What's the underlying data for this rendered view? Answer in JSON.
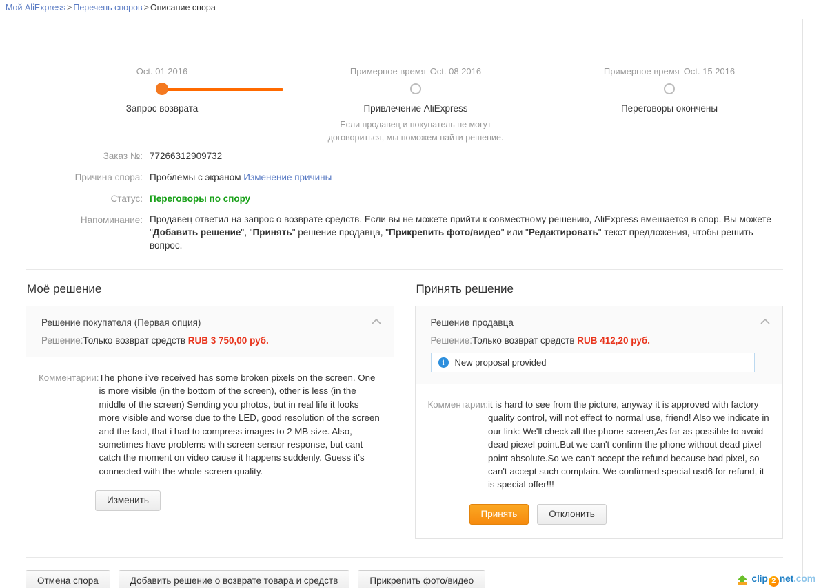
{
  "breadcrumb": {
    "items": [
      "Мой AliExpress",
      "Перечень споров",
      "Описание спора"
    ],
    "separator": ">"
  },
  "timeline": {
    "estimate_label": "Примерное время",
    "steps": [
      {
        "date": "Oct. 01 2016",
        "estimate_prefix": "",
        "label": "Запрос возврата",
        "sub": "",
        "state": "done"
      },
      {
        "date": "Oct. 08 2016",
        "estimate_prefix": "Примерное время",
        "label": "Привлечение AliExpress",
        "sub": "Если продавец и покупатель не могут договориться, мы поможем найти решение.",
        "state": "todo"
      },
      {
        "date": "Oct. 15 2016",
        "estimate_prefix": "Примерное время",
        "label": "Переговоры окончены",
        "sub": "",
        "state": "todo"
      }
    ]
  },
  "details": {
    "order_label": "Заказ №:",
    "order_value": "77266312909732",
    "reason_label": "Причина спора:",
    "reason_value": "Проблемы с экраном",
    "reason_change_link": "Изменение причины",
    "status_label": "Статус:",
    "status_value": "Переговоры по спору",
    "status_color": "#18a018",
    "reminder_label": "Напоминание:",
    "reminder_parts": [
      {
        "text": "Продавец ответил на запрос о возврате средств. Если вы не можете прийти к совместному решению, AliExpress вмешается в спор. Вы можете \"",
        "bold": false
      },
      {
        "text": "Добавить решение",
        "bold": true
      },
      {
        "text": "\", \"",
        "bold": false
      },
      {
        "text": "Принять",
        "bold": true
      },
      {
        "text": "\" решение продавца, \"",
        "bold": false
      },
      {
        "text": "Прикрепить фото/видео",
        "bold": true
      },
      {
        "text": "\" или \"",
        "bold": false
      },
      {
        "text": "Редактировать",
        "bold": true
      },
      {
        "text": "\" текст предложения, чтобы решить вопрос.",
        "bold": false
      }
    ]
  },
  "my_solution": {
    "title": "Моё решение",
    "card_title": "Решение покупателя (Первая опция)",
    "solution_label": "Решение:",
    "solution_value": "Только возврат средств",
    "amount": "RUB 3 750,00 руб.",
    "amount_color": "#e8341c",
    "comment_label": "Комментарии:",
    "comment_text": "The phone i've received has some broken pixels on the screen. One is more visible (in the bottom of the screen), other is less (in the middle of the screen) Sending you photos, but in real life it looks more visible and worse due to the LED, good resolution of the screen and the fact, that i had to compress images to 2 MB size. Also, sometimes have problems with screen sensor response, but cant catch the moment on video cause it happens suddenly. Guess it's connected with the whole screen quality.",
    "edit_button": "Изменить"
  },
  "accept_solution": {
    "title": "Принять решение",
    "card_title": "Решение продавца",
    "solution_label": "Решение:",
    "solution_value": "Только возврат средств",
    "amount": "RUB 412,20 руб.",
    "amount_color": "#e8341c",
    "notice": "New proposal provided",
    "notice_icon": "info-icon",
    "comment_label": "Комментарии:",
    "comment_text": "it is hard to see from the picture, anyway it is approved with factory quality control, will not effect to normal use, friend! Also we indicate in our link: We'll check all the phone screen,As far as possible to avoid dead piexel point.But we can't confirm the phone without dead pixel point absolute.So we can't accept the refund because bad pixel, so can't accept such complain. We confirmed special usd6 for refund, it is special offer!!!",
    "accept_button": "Принять",
    "decline_button": "Отклонить"
  },
  "footer": {
    "cancel_dispute_button": "Отмена спора",
    "add_solution_button": "Добавить решение о возврате товара и средств",
    "attach_media_button": "Прикрепить фото/видео"
  },
  "watermark": {
    "brand_c": "clip",
    "brand_2": "2",
    "brand_net": "net",
    "brand_com": ".com",
    "icon": "upload-arrow-icon"
  },
  "colors": {
    "accent_orange": "#f47920",
    "link_blue": "#5b7cc4",
    "status_green": "#18a018",
    "amount_red": "#e8341c"
  }
}
